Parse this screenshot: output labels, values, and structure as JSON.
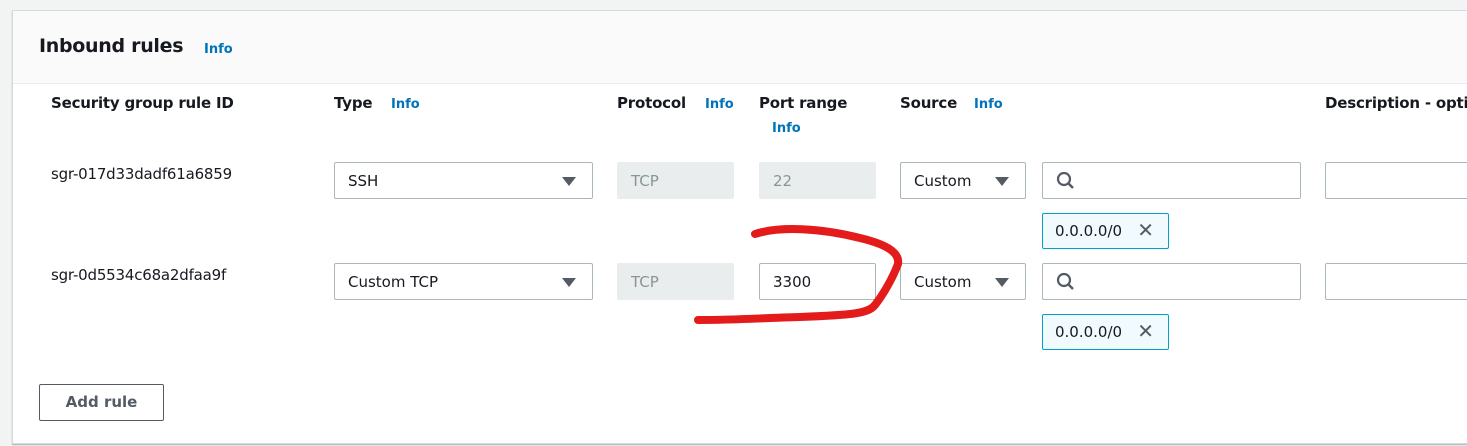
{
  "title": "Inbound rules",
  "info": "Info",
  "columns": {
    "id": "Security group rule ID",
    "type": "Type",
    "protocol": "Protocol",
    "port": "Port range",
    "source": "Source",
    "description": "Description - optional"
  },
  "rows": [
    {
      "id": "sgr-017d33dadf61a6859",
      "type": "SSH",
      "protocol": "TCP",
      "port": "22",
      "source": "Custom",
      "search": "",
      "cidr": "0.0.0.0/0",
      "description": ""
    },
    {
      "id": "sgr-0d5534c68a2dfaa9f",
      "type": "Custom TCP",
      "protocol": "TCP",
      "port": "3300",
      "source": "Custom",
      "search": "",
      "cidr": "0.0.0.0/0",
      "description": ""
    }
  ],
  "add_rule": "Add rule",
  "colors": {
    "link": "#0073bb",
    "annotation": "#e31b1b",
    "token_border": "#00a1c9"
  }
}
